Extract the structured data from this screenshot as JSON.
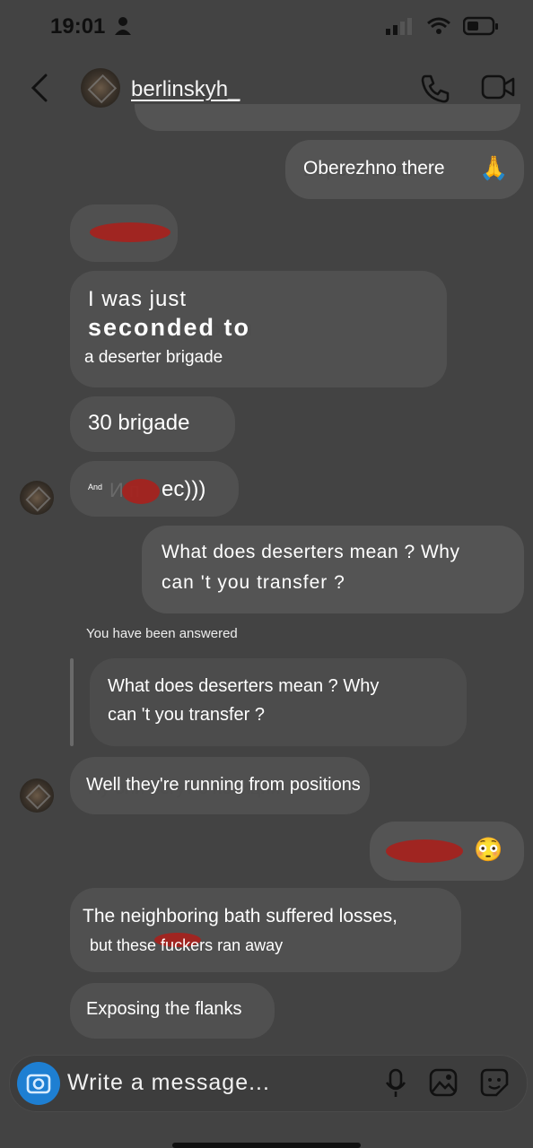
{
  "status": {
    "time": "19:01"
  },
  "header": {
    "username": "berlinskyh_"
  },
  "messages": {
    "m1": "Oberezhno there",
    "m1_emoji": "🙏",
    "m2": "I was just",
    "m2b": "seconded to",
    "m2c": "a deserter brigade",
    "m3": "30 brigade",
    "m4_small": "And",
    "m4": "ec)))",
    "m5a": "What does deserters mean ? Why",
    "m5b": "can 't you transfer ?",
    "reply_note": "You have been answered",
    "quote_a": "What does deserters mean ? Why",
    "quote_b": "can 't you transfer ?",
    "m6": "Well they're running from positions",
    "m7_emoji": "😳",
    "m8a": "The neighboring bath suffered losses,",
    "m8b": "but these fuckers ran away",
    "m9": "Exposing the flanks"
  },
  "composer": {
    "placeholder": "Write a message..."
  },
  "icons": [
    "person-icon",
    "signal-icon",
    "wifi-icon",
    "battery-icon",
    "back-arrow-icon",
    "phone-icon",
    "video-icon",
    "camera-icon",
    "microphone-icon",
    "gallery-icon",
    "sticker-icon"
  ]
}
